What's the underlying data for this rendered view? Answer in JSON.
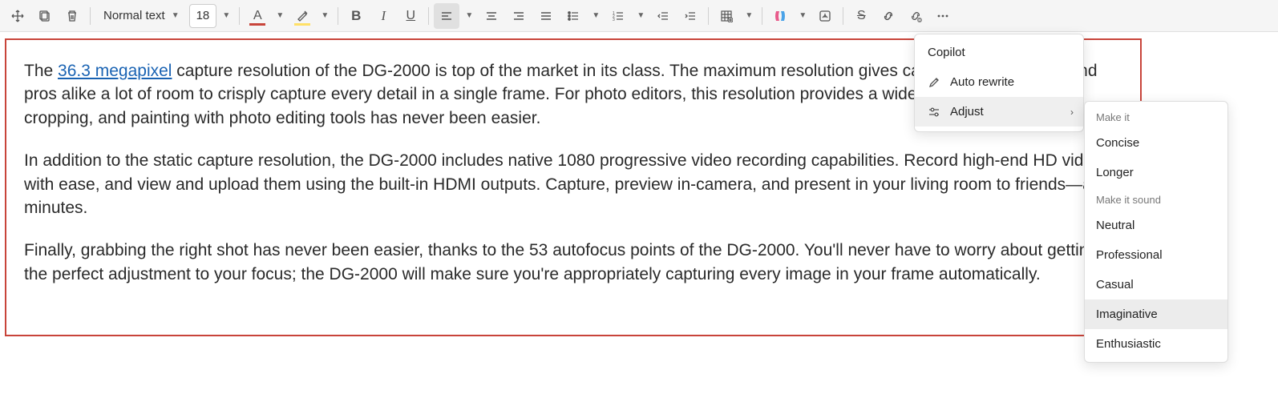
{
  "toolbar": {
    "style_label": "Normal text",
    "font_size": "18"
  },
  "document": {
    "p1_pre": "The ",
    "p1_link": "36.3 megapixel",
    "p1_post": " capture resolution of the DG-2000 is top of the market in its class. The maximum resolution gives casual photographers and pros alike a lot of room to crisply capture every detail in a single frame. For photo editors, this resolution provides a wide work area and a lot of cropping, and painting with photo editing tools has never been easier.",
    "p2": "In addition to the static capture resolution, the DG-2000 includes native 1080 progressive video recording capabilities. Record high-end HD video with ease, and view and upload them using the built-in HDMI outputs. Capture, preview in-camera, and present in your living room to friends—all in minutes.",
    "p3": "Finally, grabbing the right shot has never been easier, thanks to the 53 autofocus points of the DG-2000. You'll never have to worry about getting the perfect adjustment to your focus; the DG-2000 will make sure you're appropriately capturing every image in your frame automatically."
  },
  "copilot_menu": {
    "title": "Copilot",
    "auto_rewrite": "Auto rewrite",
    "adjust": "Adjust"
  },
  "adjust_menu": {
    "header1": "Make it",
    "concise": "Concise",
    "longer": "Longer",
    "header2": "Make it sound",
    "neutral": "Neutral",
    "professional": "Professional",
    "casual": "Casual",
    "imaginative": "Imaginative",
    "enthusiastic": "Enthusiastic"
  }
}
